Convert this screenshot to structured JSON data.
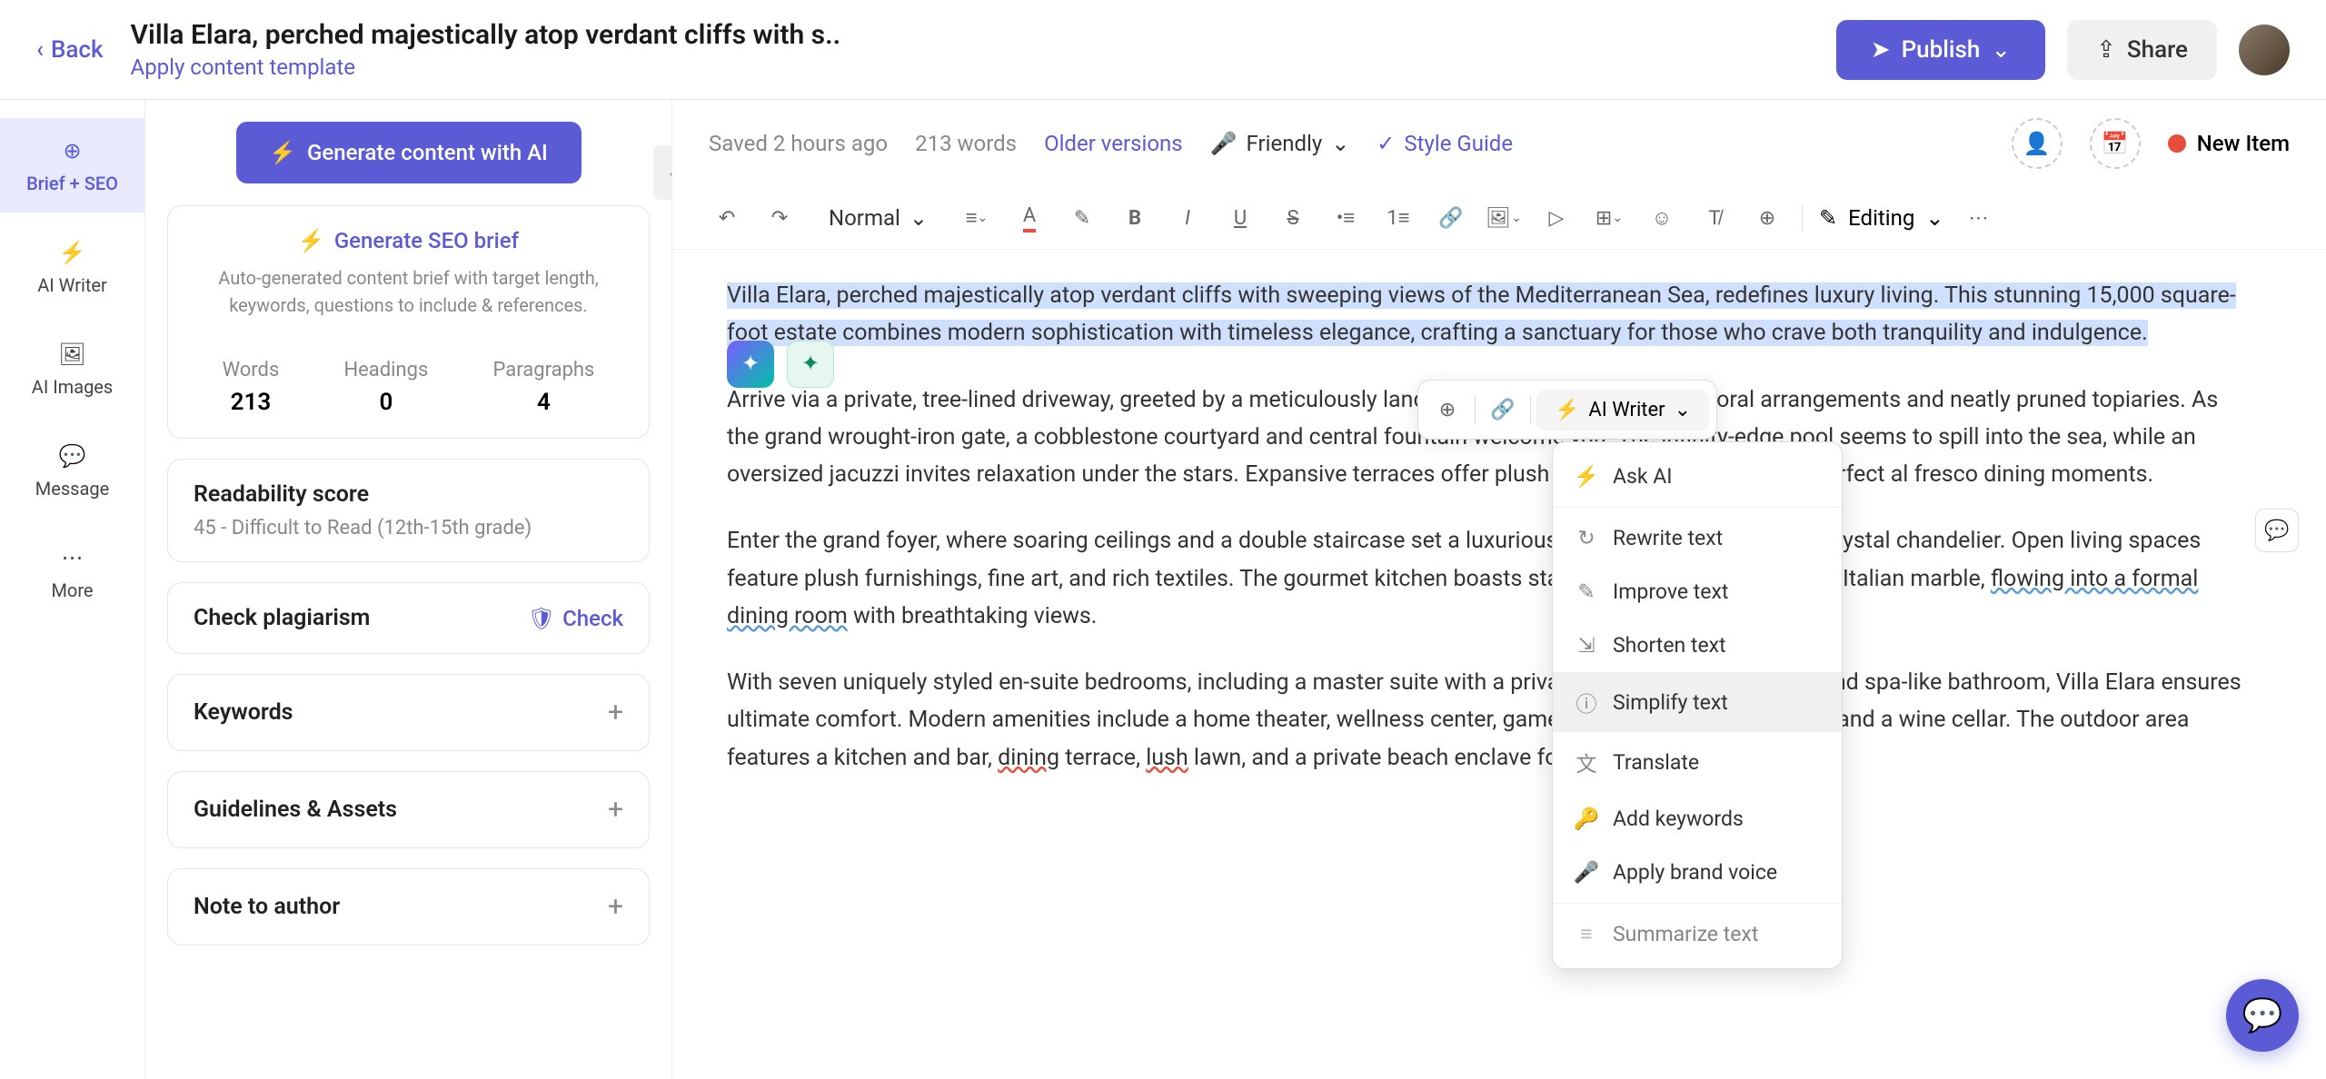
{
  "header": {
    "back": "Back",
    "title": "Villa Elara, perched majestically atop verdant cliffs with s..",
    "apply_template": "Apply content template",
    "publish": "Publish",
    "share": "Share"
  },
  "rail": {
    "brief": "Brief + SEO",
    "ai_writer": "AI Writer",
    "ai_images": "AI Images",
    "message": "Message",
    "more": "More"
  },
  "side": {
    "gen_content": "Generate content with AI",
    "gen_seo": "Generate SEO brief",
    "seo_desc": "Auto-generated content brief with target length, keywords, questions to include & references.",
    "words_label": "Words",
    "words_val": "213",
    "headings_label": "Headings",
    "headings_val": "0",
    "paragraphs_label": "Paragraphs",
    "paragraphs_val": "4",
    "readability_title": "Readability score",
    "readability_val": "45 - Difficult to Read (12th-15th grade)",
    "plagiarism_title": "Check plagiarism",
    "check": "Check",
    "keywords": "Keywords",
    "guidelines": "Guidelines & Assets",
    "note": "Note to author"
  },
  "editor_top": {
    "saved": "Saved 2 hours ago",
    "words": "213 words",
    "older": "Older versions",
    "friendly": "Friendly",
    "style_guide": "Style Guide",
    "new_item": "New Item"
  },
  "toolbar": {
    "normal": "Normal",
    "editing": "Editing"
  },
  "float": {
    "ai_writer": "AI Writer"
  },
  "menu": {
    "ask_ai": "Ask AI",
    "rewrite": "Rewrite text",
    "improve": "Improve text",
    "shorten": "Shorten text",
    "simplify": "Simplify text",
    "translate": "Translate",
    "add_keywords": "Add keywords",
    "brand_voice": "Apply brand voice",
    "summarize": "Summarize text"
  },
  "doc": {
    "p1a": "Villa Elara, perched majestically atop verdant cliffs with sweeping views of the Mediterranean Sea, redefines luxury living. This stunning 15,000 square-foot estate combines modern sophistication with timeless elegance, crafting a sanctuary for those who crave both tranquility and indulgence.",
    "p2": "Arrive via a private, tree-lined driveway, greeted by a meticulously landscaped garden with vibrant floral arrangements and neatly pruned topiaries. As the grand wrought-iron gate, a cobblestone courtyard and central fountain welcome you. The infinity-edge pool seems to spill into the sea, while an oversized jacuzzi invites relaxation under the stars. Expansive terraces offer plush loungers and a fire pit for perfect al fresco dining moments.",
    "p3": "Enter the grand foyer, where soaring ceilings and a double staircase set a luxurious tone, complemented by a crystal chandelier. Open living spaces feature plush furnishings, fine art, and rich textiles. The gourmet kitchen boasts state-of-the-art appliances and Italian marble, ",
    "p3_flowing": "flowing into a formal dining room",
    "p3_end": " with breathtaking views.",
    "p4a": "With seven uniquely styled en-suite bedrooms, including a master suite with a private terrace, dressing room, and spa-like bathroom, Villa Elara ensures ultimate comfort. Modern amenities include a home theater, wellness center, game room, sophisticated office, and a wine cellar. The outdoor area features a kitchen and bar, ",
    "p4_dining": "dining",
    "p4b": " terrace, ",
    "p4_lush": "lush",
    "p4c": " lawn, and a private beach enclave for unparalleled leisure."
  }
}
